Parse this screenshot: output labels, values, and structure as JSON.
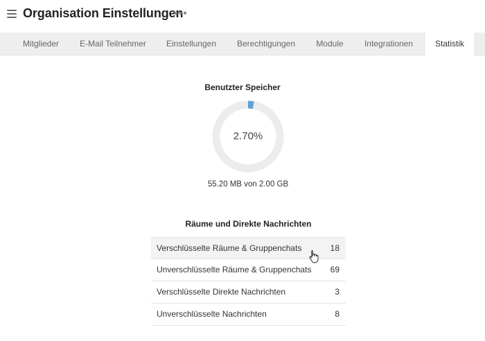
{
  "header": {
    "title": "Organisation Einstellungen",
    "more_label": "•••"
  },
  "tabs": [
    {
      "label": "Mitglieder",
      "active": false
    },
    {
      "label": "E-Mail Teilnehmer",
      "active": false
    },
    {
      "label": "Einstellungen",
      "active": false
    },
    {
      "label": "Berechtigungen",
      "active": false
    },
    {
      "label": "Module",
      "active": false
    },
    {
      "label": "Integrationen",
      "active": false
    },
    {
      "label": "Statistik",
      "active": true
    }
  ],
  "storage": {
    "title": "Benutzter Speicher",
    "percent_label": "2.70%",
    "percent_value": 2.7,
    "usage_text": "55.20 MB von 2.00 GB",
    "ring_color": "#ececec",
    "fill_color": "#5ba3d9"
  },
  "rooms": {
    "title": "Räume und Direkte Nachrichten",
    "rows": [
      {
        "label": "Verschlüsselte Räume & Gruppenchats",
        "value": "18"
      },
      {
        "label": "Unverschlüsselte Räume & Gruppenchats",
        "value": "69"
      },
      {
        "label": "Verschlüsselte Direkte Nachrichten",
        "value": "3"
      },
      {
        "label": "Unverschlüsselte Nachrichten",
        "value": "8"
      }
    ]
  }
}
